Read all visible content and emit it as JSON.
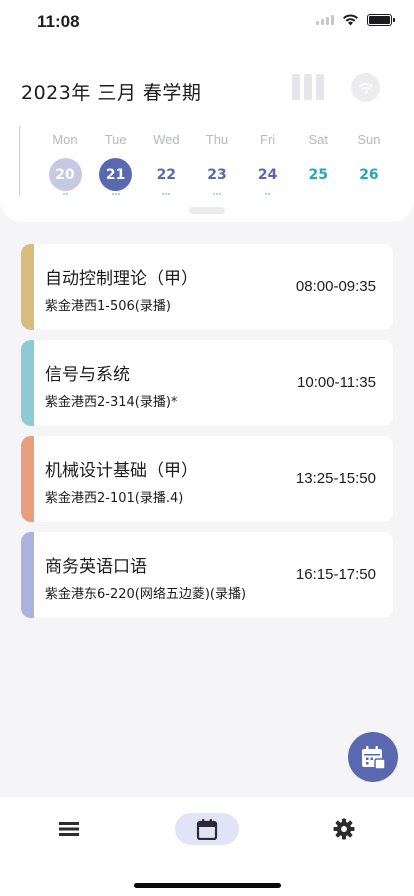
{
  "status_bar": {
    "time": "11:08"
  },
  "header": {
    "term_title": "2023年 三月 春学期"
  },
  "week": [
    {
      "name": "Mon",
      "date": "20",
      "state": "past",
      "dots": 2
    },
    {
      "name": "Tue",
      "date": "21",
      "state": "today",
      "dots": 3
    },
    {
      "name": "Wed",
      "date": "22",
      "state": "normal",
      "dots": 3
    },
    {
      "name": "Thu",
      "date": "23",
      "state": "normal",
      "dots": 3
    },
    {
      "name": "Fri",
      "date": "24",
      "state": "normal",
      "dots": 2
    },
    {
      "name": "Sat",
      "date": "25",
      "state": "weekend",
      "dots": 0
    },
    {
      "name": "Sun",
      "date": "26",
      "state": "weekend",
      "dots": 0
    }
  ],
  "courses": [
    {
      "name": "自动控制理论（甲）",
      "room": "紫金港西1-506(录播)",
      "time": "08:00-09:35",
      "color": "#d9bc7c"
    },
    {
      "name": "信号与系统",
      "room": "紫金港西2-314(录播)*",
      "time": "10:00-11:35",
      "color": "#8ccbd3"
    },
    {
      "name": "机械设计基础（甲）",
      "room": "紫金港西2-101(录播.4)",
      "time": "13:25-15:50",
      "color": "#e8a07c"
    },
    {
      "name": "商务英语口语",
      "room": "紫金港东6-220(网络五边菱)(录播)",
      "time": "16:15-17:50",
      "color": "#aab2dd"
    }
  ],
  "colors": {
    "accent": "#5a68b0",
    "accent_light": "#c6c9e2",
    "weekend": "#2aa6b8",
    "tab_active_bg": "#e1e4f6"
  },
  "tab_bar": {
    "tabs": [
      {
        "icon": "list-icon",
        "active": false
      },
      {
        "icon": "calendar-icon",
        "active": true
      },
      {
        "icon": "gear-icon",
        "active": false
      }
    ]
  },
  "fab": {
    "icon": "calendar-add-icon"
  }
}
